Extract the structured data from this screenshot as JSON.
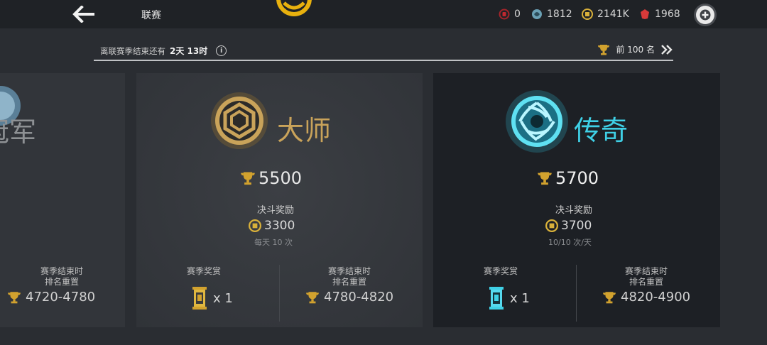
{
  "header": {
    "title": "联赛",
    "currencies": [
      {
        "icon": "red-gem-icon",
        "value": "0",
        "color": "#c0282f"
      },
      {
        "icon": "swirl-token-icon",
        "value": "1812",
        "color": "#7fb0c0"
      },
      {
        "icon": "gold-coin-icon",
        "value": "2141K",
        "color": "#d9b13a"
      },
      {
        "icon": "red-crystal-icon",
        "value": "1968",
        "color": "#d83a3a"
      }
    ]
  },
  "season": {
    "remaining_label": "离联赛季结束还有",
    "remaining_value": "2天 13时",
    "top_label": "前 100 名"
  },
  "tiers": {
    "left": {
      "name": "冠军",
      "reset_label_1": "赛季结束时",
      "reset_label_2": "排名重置",
      "range": "4720-4780"
    },
    "master": {
      "name": "大师",
      "trophies": "5500",
      "reward_title": "决斗奖励",
      "coins": "3300",
      "note": "每天 10 次",
      "season_reward_label": "赛季奖赏",
      "season_reward_count": "x 1",
      "reset_label_1": "赛季结束时",
      "reset_label_2": "排名重置",
      "range": "4780-4820",
      "color": "#c9a35a"
    },
    "legend": {
      "name": "传奇",
      "trophies": "5700",
      "reward_title": "决斗奖励",
      "coins": "3700",
      "note": "10/10 次/天",
      "season_reward_label": "赛季奖赏",
      "season_reward_count": "x 1",
      "reset_label_1": "赛季结束时",
      "reset_label_2": "排名重置",
      "range": "4820-4900",
      "color": "#3fd0e6"
    }
  },
  "colors": {
    "gold": "#d2a22e",
    "cyan": "#3fd0e6"
  }
}
